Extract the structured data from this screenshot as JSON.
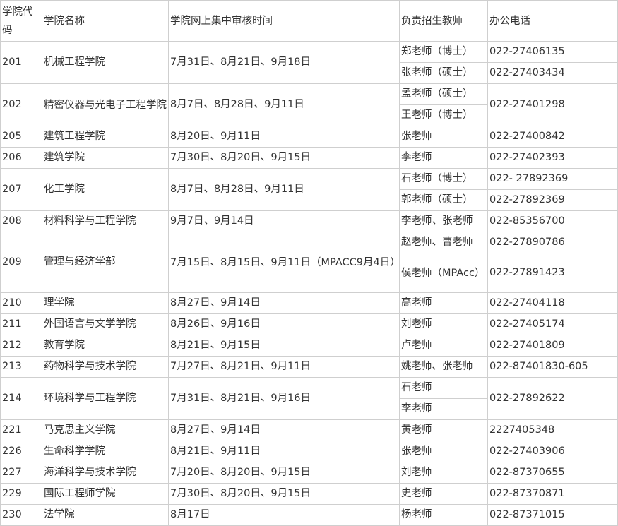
{
  "header": {
    "code": "学院代码",
    "name": "学院名称",
    "time": "学院网上集中审核时间",
    "teacher": "负责招生教师",
    "phone": "办公电话"
  },
  "rows": [
    {
      "code": "201",
      "name": "机械工程学院",
      "time": "7月31日、8月21日、9月18日",
      "teachers": [
        {
          "name": "郑老师（博士）",
          "phone": "022-27406135"
        },
        {
          "name": "张老师（硕士）",
          "phone": "022-27403434"
        }
      ]
    },
    {
      "code": "202",
      "name": "精密仪器与光电子工程学院",
      "time": "8月7日、8月28日、9月11日",
      "teachers": [
        {
          "name": "孟老师（硕士）"
        },
        {
          "name": "王老师（博士）"
        }
      ],
      "phone": "022-27401298"
    },
    {
      "code": "205",
      "name": "建筑工程学院",
      "time": "8月20日、9月11日",
      "teachers": [
        {
          "name": "张老师"
        }
      ],
      "phone": "022-27400842"
    },
    {
      "code": "206",
      "name": "建筑学院",
      "time": "7月30日、8月20日、9月15日",
      "teachers": [
        {
          "name": "李老师"
        }
      ],
      "phone": "022-27402393"
    },
    {
      "code": "207",
      "name": "化工学院",
      "time": "8月7日、8月28日、9月11日",
      "teachers": [
        {
          "name": "石老师（博士）",
          "phone": "022- 27892369"
        },
        {
          "name": "郭老师（硕士）",
          "phone": "022-27892369"
        }
      ]
    },
    {
      "code": "208",
      "name": "材料科学与工程学院",
      "time": "9月7日、9月14日",
      "teachers": [
        {
          "name": "李老师、张老师"
        }
      ],
      "phone": "022-85356700"
    },
    {
      "code": "209",
      "name": "管理与经济学部",
      "time": "7月15日、8月15日、9月11日（MPACC9月4日）",
      "teachers": [
        {
          "name": "赵老师、曹老师",
          "phone": "022-27890786"
        },
        {
          "name": "侯老师（MPAcc）",
          "phone": "022-27891423"
        }
      ]
    },
    {
      "code": "210",
      "name": "理学院",
      "time": "8月27日、9月14日",
      "teachers": [
        {
          "name": "高老师"
        }
      ],
      "phone": "022-27404118"
    },
    {
      "code": "211",
      "name": "外国语言与文学学院",
      "time": "8月26日、9月16日",
      "teachers": [
        {
          "name": "刘老师"
        }
      ],
      "phone": "022-27405174"
    },
    {
      "code": "212",
      "name": "教育学院",
      "time": "8月21日、9月15日",
      "teachers": [
        {
          "name": "卢老师"
        }
      ],
      "phone": "022-27401809"
    },
    {
      "code": "213",
      "name": "药物科学与技术学院",
      "time": "7月27日、8月21日、9月11日",
      "teachers": [
        {
          "name": "姚老师、张老师"
        }
      ],
      "phone": "022-87401830-605"
    },
    {
      "code": "214",
      "name": "环境科学与工程学院",
      "time": "7月31日、8月21日、9月16日",
      "teachers": [
        {
          "name": "石老师"
        },
        {
          "name": "李老师"
        }
      ],
      "phone": "022-27892622"
    },
    {
      "code": "221",
      "name": "马克思主义学院",
      "time": "8月27日、9月14日",
      "teachers": [
        {
          "name": "黄老师"
        }
      ],
      "phone": "2227405348"
    },
    {
      "code": "226",
      "name": "生命科学学院",
      "time": "8月21日、9月11日",
      "teachers": [
        {
          "name": "张老师"
        }
      ],
      "phone": "022-27403906"
    },
    {
      "code": "227",
      "name": "海洋科学与技术学院",
      "time": "7月20日、8月20日、9月15日",
      "teachers": [
        {
          "name": "刘老师"
        }
      ],
      "phone": "022-87370655"
    },
    {
      "code": "229",
      "name": "国际工程师学院",
      "time": "7月30日、8月20日、9月15日",
      "teachers": [
        {
          "name": "史老师"
        }
      ],
      "phone": "022-87370871"
    },
    {
      "code": "230",
      "name": "法学院",
      "time": "8月17日",
      "teachers": [
        {
          "name": "杨老师"
        }
      ],
      "phone": "022-87371015"
    }
  ]
}
